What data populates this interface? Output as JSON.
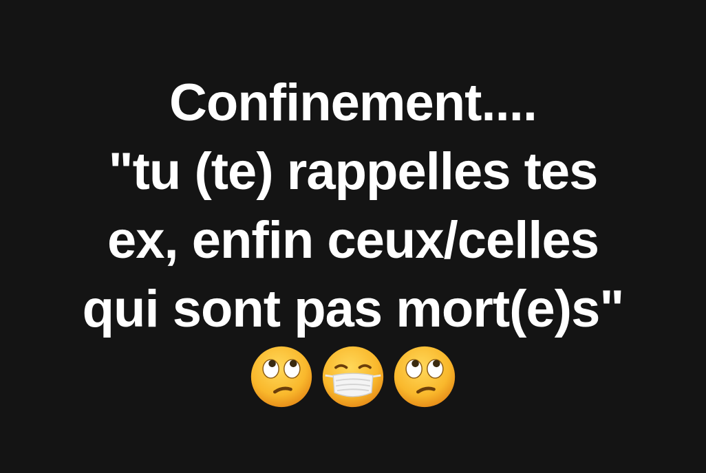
{
  "post": {
    "lines": [
      "Confinement....",
      "\"tu (te) rappelles tes",
      "ex, enfin ceux/celles",
      "qui sont pas mort(e)s\""
    ],
    "emojis": [
      "face-with-rolling-eyes-icon",
      "face-with-medical-mask-icon",
      "face-with-rolling-eyes-icon"
    ],
    "colors": {
      "background": "#141414",
      "text": "#ffffff",
      "emoji_face": "#f7b928"
    }
  }
}
